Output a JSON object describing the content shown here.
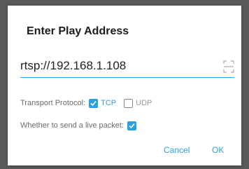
{
  "dialog": {
    "title": "Enter Play Address",
    "address": {
      "value": "rtsp://192.168.1.108",
      "scan_icon": "scan-qr-icon"
    },
    "transport": {
      "label": "Transport Protocol:",
      "options": [
        {
          "label": "TCP",
          "checked": true
        },
        {
          "label": "UDP",
          "checked": false
        }
      ]
    },
    "live_packet": {
      "label": "Whether to send a live packet:",
      "checked": true
    },
    "buttons": {
      "cancel": "Cancel",
      "ok": "OK"
    }
  },
  "colors": {
    "accent": "#2ba0e0",
    "backdrop": "#5a5a5a",
    "dialog_bg": "#ffffff"
  }
}
